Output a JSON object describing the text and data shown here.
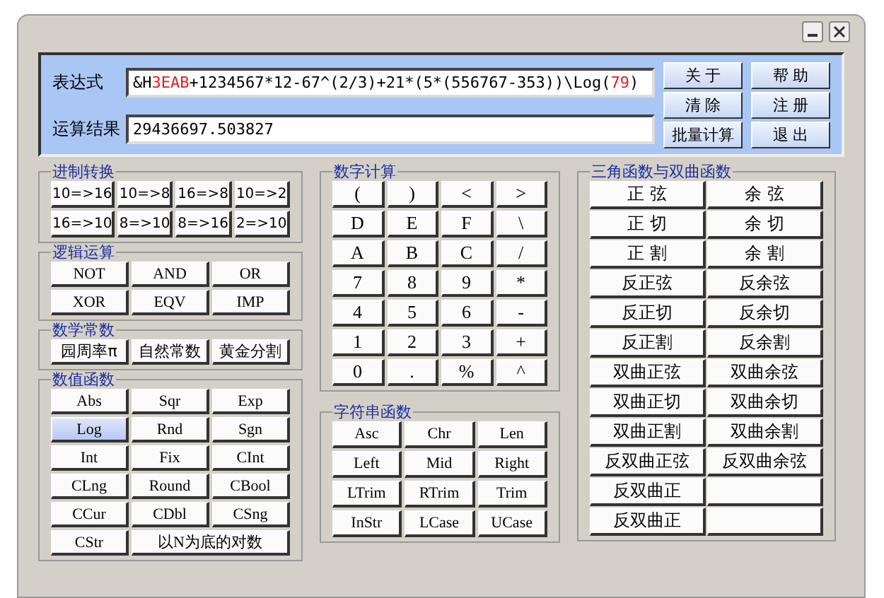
{
  "window": {
    "controls": [
      {
        "kind": "minimize"
      },
      {
        "kind": "close"
      }
    ]
  },
  "top_panel": {
    "expression_label": "表达式",
    "expression": [
      {
        "text": "&H",
        "color": "#000000"
      },
      {
        "text": "3EAB",
        "color": "#e02020"
      },
      {
        "text": "+1234567*12-67^(2/3)+21*(5*(556767-353))\\Log(",
        "color": "#000000"
      },
      {
        "text": "79",
        "color": "#e02020"
      },
      {
        "text": ")",
        "color": "#000000"
      }
    ],
    "result_label": "运算结果",
    "result": "29436697.503827",
    "buttons": [
      "关 于",
      "帮 助",
      "清 除",
      "注 册",
      "批量计算",
      "退 出"
    ]
  },
  "base_conversion": {
    "title": "进制转换",
    "buttons": [
      "10=>16",
      "10=>8",
      "16=>8",
      "10=>2",
      "16=>10",
      "8=>10",
      "8=>16",
      "2=>10"
    ]
  },
  "logic": {
    "title": "逻辑运算",
    "buttons": [
      "NOT",
      "AND",
      "OR",
      "XOR",
      "EQV",
      "IMP"
    ]
  },
  "constants": {
    "title": "数学常数",
    "buttons": [
      "园周率π",
      "自然常数",
      "黄金分割"
    ]
  },
  "numeric_functions": {
    "title": "数值函数",
    "buttons": [
      {
        "label": "Abs",
        "selected": false
      },
      {
        "label": "Sqr",
        "selected": false
      },
      {
        "label": "Exp",
        "selected": false
      },
      {
        "label": "Log",
        "selected": true
      },
      {
        "label": "Rnd",
        "selected": false
      },
      {
        "label": "Sgn",
        "selected": false
      },
      {
        "label": "Int",
        "selected": false
      },
      {
        "label": "Fix",
        "selected": false
      },
      {
        "label": "CInt",
        "selected": false
      },
      {
        "label": "CLng",
        "selected": false
      },
      {
        "label": "Round",
        "selected": false
      },
      {
        "label": "CBool",
        "selected": false
      },
      {
        "label": "CCur",
        "selected": false
      },
      {
        "label": "CDbl",
        "selected": false
      },
      {
        "label": "CSng",
        "selected": false
      },
      {
        "label": "CStr",
        "selected": false
      },
      {
        "label": "以N为底的对数",
        "selected": false
      }
    ]
  },
  "keypad": {
    "title": "数字计算",
    "keys": [
      "(",
      ")",
      "<",
      ">",
      "D",
      "E",
      "F",
      "\\",
      "A",
      "B",
      "C",
      "/",
      "7",
      "8",
      "9",
      "*",
      "4",
      "5",
      "6",
      "-",
      "1",
      "2",
      "3",
      "+",
      "0",
      ".",
      "%",
      "^"
    ]
  },
  "string_functions": {
    "title": "字符串函数",
    "buttons": [
      "Asc",
      "Chr",
      "Len",
      "Left",
      "Mid",
      "Right",
      "LTrim",
      "RTrim",
      "Trim",
      "InStr",
      "LCase",
      "UCase"
    ]
  },
  "trig_functions": {
    "title": "三角函数与双曲函数",
    "rows": [
      [
        "正 弦",
        "余 弦"
      ],
      [
        "正 切",
        "余 切"
      ],
      [
        "正 割",
        "余 割"
      ],
      [
        "反正弦",
        "反余弦"
      ],
      [
        "反正切",
        "反余切"
      ],
      [
        "反正割",
        "反余割"
      ],
      [
        "双曲正弦",
        "双曲余弦"
      ],
      [
        "双曲正切",
        "双曲余切"
      ],
      [
        "双曲正割",
        "双曲余割"
      ],
      [
        "反双曲正弦",
        "反双曲余弦"
      ],
      [
        "反双曲正"
      ],
      [
        "反双曲正"
      ]
    ]
  }
}
